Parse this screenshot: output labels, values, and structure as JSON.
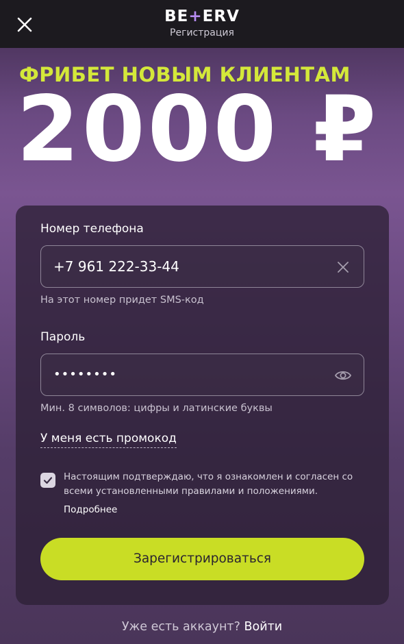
{
  "header": {
    "logo_left": "BE",
    "logo_plus": "+",
    "logo_right": "ERV",
    "subtitle": "Регистрация"
  },
  "promo": {
    "headline": "ФРИБЕТ НОВЫМ КЛИЕНТАМ",
    "amount": "2000 ₽"
  },
  "form": {
    "phone": {
      "label": "Номер телефона",
      "value": "+7 961 222-33-44",
      "hint": "На этот номер придет SMS-код"
    },
    "password": {
      "label": "Пароль",
      "value": "••••••••",
      "hint": "Мин. 8 символов: цифры и латинские буквы"
    },
    "promo_code_link": "У меня есть промокод",
    "consent": {
      "checked": true,
      "text": "Настоящим подтверждаю, что я ознакомлен и согласен со всеми установленными правилами и положениями.",
      "more": "Подробнее"
    },
    "submit_label": "Зарегистрироваться"
  },
  "footer": {
    "question": "Уже есть аккаунт?",
    "login_link": "Войти"
  },
  "colors": {
    "accent_yellow": "#c9dd25",
    "headline_yellow": "#d4e83a",
    "logo_purple": "#b68bf0",
    "topbar": "#1c1a1f"
  }
}
